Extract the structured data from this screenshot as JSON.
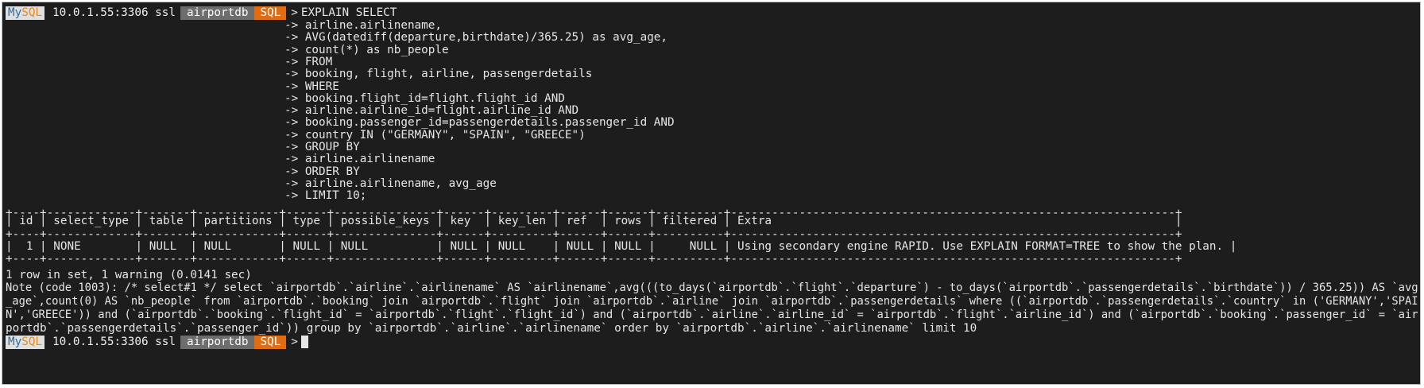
{
  "prompt": {
    "mysql_my": "My",
    "mysql_sql": "SQL",
    "host": "10.0.1.55:3306 ssl",
    "db": "airportdb",
    "mode": "SQL",
    "arrow": ">"
  },
  "query": {
    "first_line": "EXPLAIN SELECT",
    "continuation_prefix": "->",
    "lines": [
      "airline.airlinename,",
      "AVG(datediff(departure,birthdate)/365.25) as avg_age,",
      "count(*) as nb_people",
      "FROM",
      "booking, flight, airline, passengerdetails",
      "WHERE",
      "booking.flight_id=flight.flight_id AND",
      "airline.airline_id=flight.airline_id AND",
      "booking.passenger_id=passengerdetails.passenger_id AND",
      "country IN (\"GERMANY\", \"SPAIN\", \"GREECE\")",
      "GROUP BY",
      "airline.airlinename",
      "ORDER BY",
      "airline.airlinename, avg_age",
      "LIMIT 10;"
    ]
  },
  "result_table": {
    "border": "+----+-------------+-------+------------+------+---------------+------+---------+------+------+----------+-----------------------------------------------------------------+",
    "header": "| id | select_type | table | partitions | type | possible_keys | key  | key_len | ref  | rows | filtered | Extra                                                           |",
    "row": "|  1 | NONE        | NULL  | NULL       | NULL | NULL          | NULL | NULL    | NULL | NULL |     NULL | Using secondary engine RAPID. Use EXPLAIN FORMAT=TREE to show the plan. |",
    "columns": [
      "id",
      "select_type",
      "table",
      "partitions",
      "type",
      "possible_keys",
      "key",
      "key_len",
      "ref",
      "rows",
      "filtered",
      "Extra"
    ],
    "values": [
      "1",
      "NONE",
      "NULL",
      "NULL",
      "NULL",
      "NULL",
      "NULL",
      "NULL",
      "NULL",
      "NULL",
      "NULL",
      "Using secondary engine RAPID. Use EXPLAIN FORMAT=TREE to show the plan."
    ]
  },
  "summary": "1 row in set, 1 warning (0.0141 sec)",
  "note_lines": [
    "Note (code 1003): /* select#1 */ select `airportdb`.`airline`.`airlinename` AS `airlinename`,avg(((to_days(`airportdb`.`flight`.`departure`) - to_days(`airportdb`.`passengerdetails`.`birthdate`)) / 365.25)) AS `avg",
    "_age`,count(0) AS `nb_people` from `airportdb`.`booking` join `airportdb`.`flight` join `airportdb`.`airline` join `airportdb`.`passengerdetails` where ((`airportdb`.`passengerdetails`.`country` in ('GERMANY','SPAI",
    "N','GREECE')) and (`airportdb`.`booking`.`flight_id` = `airportdb`.`flight`.`flight_id`) and (`airportdb`.`airline`.`airline_id` = `airportdb`.`flight`.`airline_id`) and (`airportdb`.`booking`.`passenger_id` = `air",
    "portdb`.`passengerdetails`.`passenger_id`)) group by `airportdb`.`airline`.`airlinename` order by `airportdb`.`airline`.`airlinename` limit 10"
  ]
}
